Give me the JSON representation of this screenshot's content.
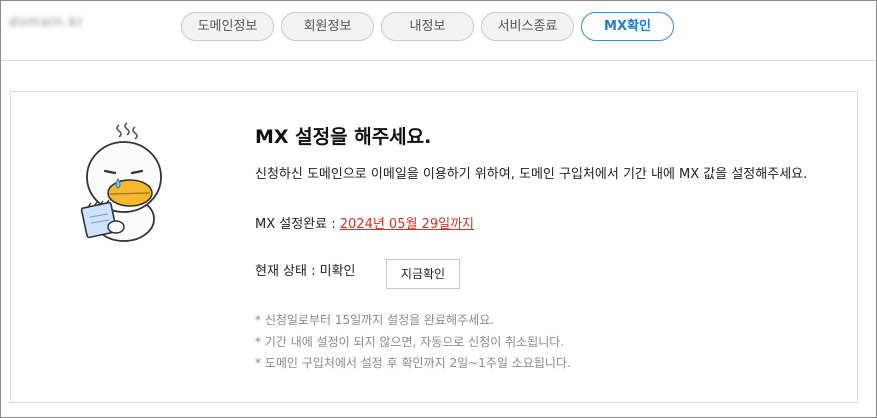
{
  "header": {
    "domain_name": "domain.kr"
  },
  "tabs": [
    {
      "label": "도메인정보",
      "active": false
    },
    {
      "label": "회원정보",
      "active": false
    },
    {
      "label": "내정보",
      "active": false
    },
    {
      "label": "서비스종료",
      "active": false
    },
    {
      "label": "MX확인",
      "active": true
    }
  ],
  "colors": {
    "accent": "#1f7fd6",
    "deadline": "#d93025",
    "mascot_beak": "#f5b82e"
  },
  "mx": {
    "title": "MX 설정을 해주세요.",
    "description": "신청하신 도메인으로 이메일을 이용하기 위하여, 도메인 구입처에서 기간 내에 MX 값을 설정해주세요.",
    "completion_label": "MX 설정완료 : ",
    "completion_date": "2024년 05월 29일까지",
    "status_label": "현재 상태 : 미확인",
    "check_button": "지금확인",
    "notes": [
      "* 신청일로부터 15일까지 설정을 완료해주세요.",
      "* 기간 내에 설정이 되지 않으면, 자동으로 신청이 취소됩니다.",
      "* 도메인 구입처에서 설정 후 확인까지 2일~1주일 소요됩니다."
    ],
    "mascot_icon": "worried-character-icon"
  }
}
